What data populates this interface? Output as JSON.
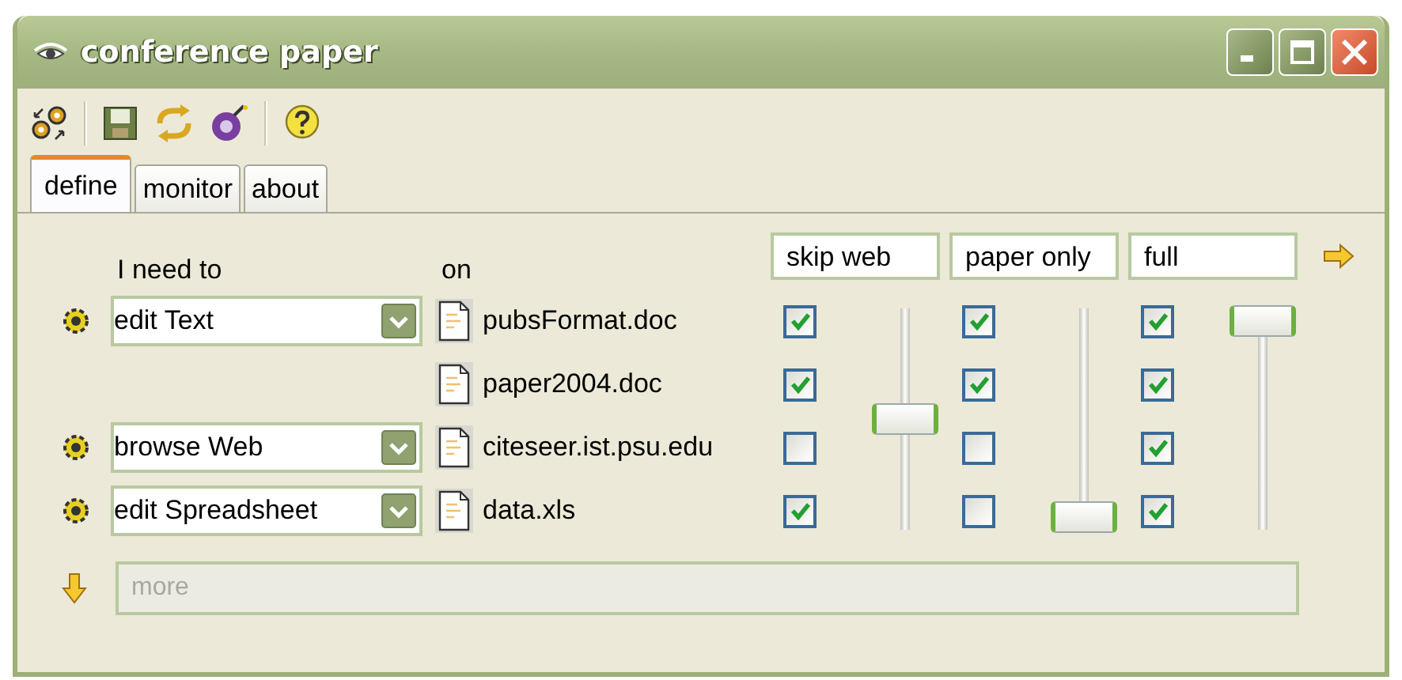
{
  "window": {
    "title": "conference paper"
  },
  "tabs": [
    {
      "label": "define",
      "selected": true
    },
    {
      "label": "monitor",
      "selected": false
    },
    {
      "label": "about",
      "selected": false
    }
  ],
  "columns": {
    "action": "I need to",
    "target": "on"
  },
  "profiles": [
    {
      "name": "skip web",
      "level": 0.5
    },
    {
      "name": "paper only",
      "level": 0
    },
    {
      "name": "full",
      "level": 1
    }
  ],
  "rows": [
    {
      "action": "edit Text",
      "file": "pubsFormat.doc",
      "checks": [
        true,
        true,
        true
      ]
    },
    {
      "file": "paper2004.doc",
      "checks": [
        true,
        true,
        true
      ]
    },
    {
      "action": "browse Web",
      "file": "citeseer.ist.psu.edu",
      "checks": [
        false,
        false,
        true
      ]
    },
    {
      "action": "edit Spreadsheet",
      "file": "data.xls",
      "checks": [
        true,
        false,
        true
      ]
    }
  ],
  "more": {
    "placeholder": "more"
  }
}
